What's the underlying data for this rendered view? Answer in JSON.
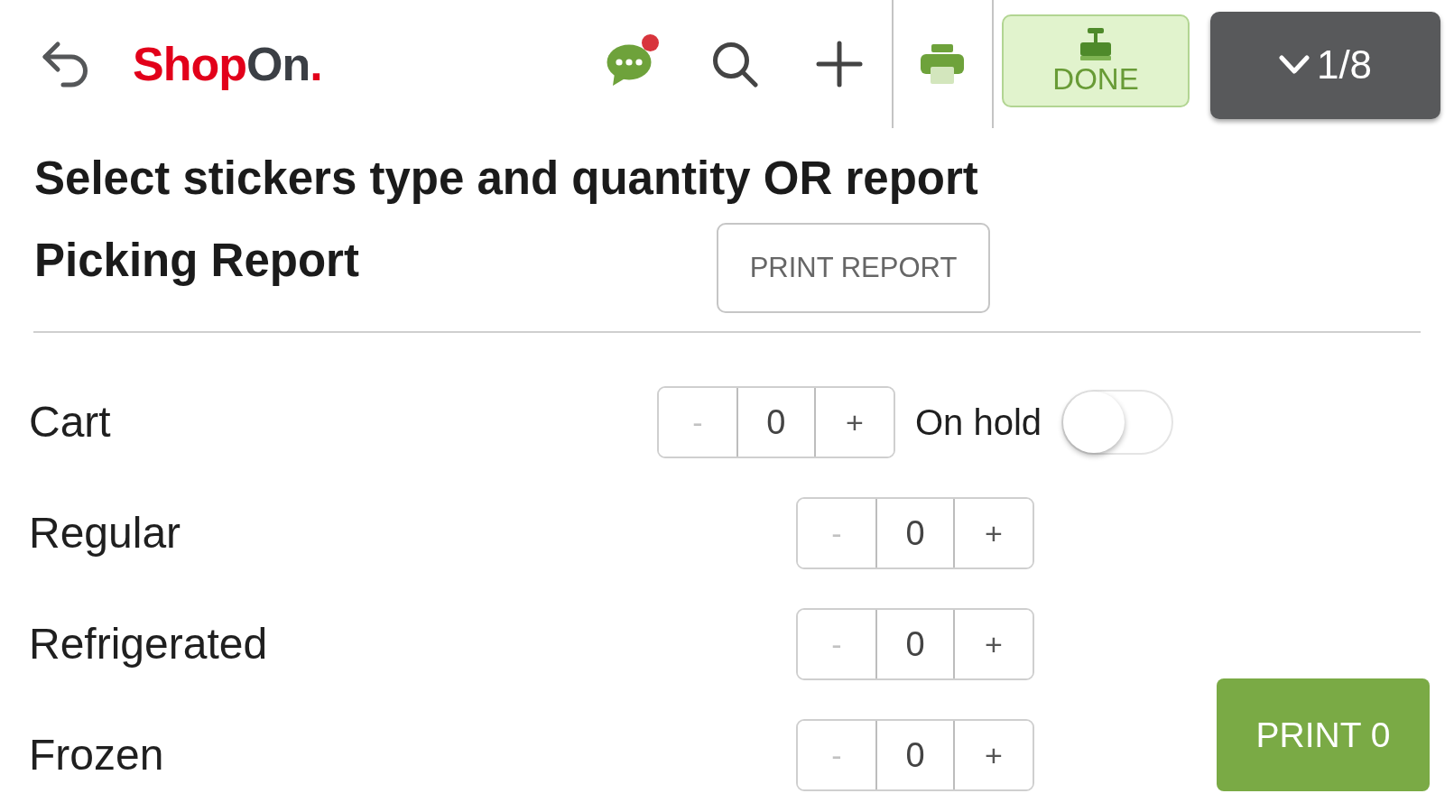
{
  "header": {
    "logo": [
      "Shop",
      "On",
      "."
    ],
    "chat": {
      "unread": true
    },
    "done_button": "DONE",
    "pager_button": "1/8"
  },
  "title": "Select stickers type and quantity OR report",
  "report": {
    "label": "Picking Report",
    "button": "PRINT REPORT"
  },
  "stickers": [
    {
      "kind": "with_toggle",
      "name": "Cart",
      "stepper": {
        "minus": "-",
        "value": "0",
        "plus": "+",
        "minus_disabled": true
      },
      "toggle": {
        "label": "On hold",
        "on": false
      }
    },
    {
      "kind": "stepper",
      "name": "Regular",
      "stepper": {
        "minus": "-",
        "value": "0",
        "plus": "+",
        "minus_disabled": true
      }
    },
    {
      "kind": "stepper",
      "name": "Refrigerated",
      "stepper": {
        "minus": "-",
        "value": "0",
        "plus": "+",
        "minus_disabled": true
      }
    },
    {
      "kind": "stepper",
      "name": "Frozen",
      "stepper": {
        "minus": "-",
        "value": "0",
        "plus": "+",
        "minus_disabled": true
      }
    }
  ],
  "print_button": "PRINT 0"
}
